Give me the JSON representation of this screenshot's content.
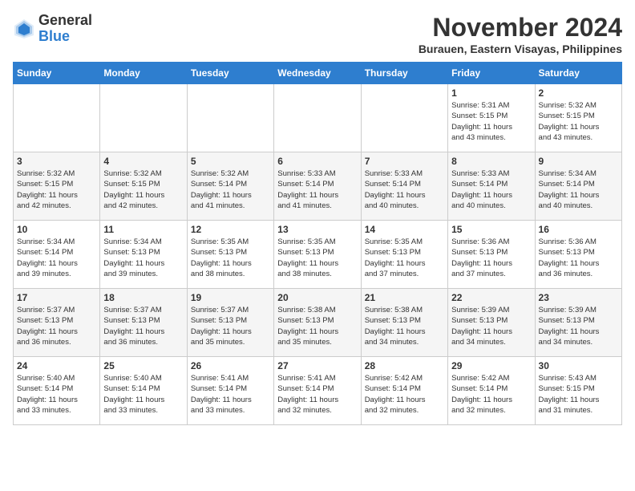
{
  "header": {
    "logo_general": "General",
    "logo_blue": "Blue",
    "month_year": "November 2024",
    "location": "Burauen, Eastern Visayas, Philippines"
  },
  "days_of_week": [
    "Sunday",
    "Monday",
    "Tuesday",
    "Wednesday",
    "Thursday",
    "Friday",
    "Saturday"
  ],
  "weeks": [
    [
      {
        "day": "",
        "info": ""
      },
      {
        "day": "",
        "info": ""
      },
      {
        "day": "",
        "info": ""
      },
      {
        "day": "",
        "info": ""
      },
      {
        "day": "",
        "info": ""
      },
      {
        "day": "1",
        "info": "Sunrise: 5:31 AM\nSunset: 5:15 PM\nDaylight: 11 hours\nand 43 minutes."
      },
      {
        "day": "2",
        "info": "Sunrise: 5:32 AM\nSunset: 5:15 PM\nDaylight: 11 hours\nand 43 minutes."
      }
    ],
    [
      {
        "day": "3",
        "info": "Sunrise: 5:32 AM\nSunset: 5:15 PM\nDaylight: 11 hours\nand 42 minutes."
      },
      {
        "day": "4",
        "info": "Sunrise: 5:32 AM\nSunset: 5:15 PM\nDaylight: 11 hours\nand 42 minutes."
      },
      {
        "day": "5",
        "info": "Sunrise: 5:32 AM\nSunset: 5:14 PM\nDaylight: 11 hours\nand 41 minutes."
      },
      {
        "day": "6",
        "info": "Sunrise: 5:33 AM\nSunset: 5:14 PM\nDaylight: 11 hours\nand 41 minutes."
      },
      {
        "day": "7",
        "info": "Sunrise: 5:33 AM\nSunset: 5:14 PM\nDaylight: 11 hours\nand 40 minutes."
      },
      {
        "day": "8",
        "info": "Sunrise: 5:33 AM\nSunset: 5:14 PM\nDaylight: 11 hours\nand 40 minutes."
      },
      {
        "day": "9",
        "info": "Sunrise: 5:34 AM\nSunset: 5:14 PM\nDaylight: 11 hours\nand 40 minutes."
      }
    ],
    [
      {
        "day": "10",
        "info": "Sunrise: 5:34 AM\nSunset: 5:14 PM\nDaylight: 11 hours\nand 39 minutes."
      },
      {
        "day": "11",
        "info": "Sunrise: 5:34 AM\nSunset: 5:13 PM\nDaylight: 11 hours\nand 39 minutes."
      },
      {
        "day": "12",
        "info": "Sunrise: 5:35 AM\nSunset: 5:13 PM\nDaylight: 11 hours\nand 38 minutes."
      },
      {
        "day": "13",
        "info": "Sunrise: 5:35 AM\nSunset: 5:13 PM\nDaylight: 11 hours\nand 38 minutes."
      },
      {
        "day": "14",
        "info": "Sunrise: 5:35 AM\nSunset: 5:13 PM\nDaylight: 11 hours\nand 37 minutes."
      },
      {
        "day": "15",
        "info": "Sunrise: 5:36 AM\nSunset: 5:13 PM\nDaylight: 11 hours\nand 37 minutes."
      },
      {
        "day": "16",
        "info": "Sunrise: 5:36 AM\nSunset: 5:13 PM\nDaylight: 11 hours\nand 36 minutes."
      }
    ],
    [
      {
        "day": "17",
        "info": "Sunrise: 5:37 AM\nSunset: 5:13 PM\nDaylight: 11 hours\nand 36 minutes."
      },
      {
        "day": "18",
        "info": "Sunrise: 5:37 AM\nSunset: 5:13 PM\nDaylight: 11 hours\nand 36 minutes."
      },
      {
        "day": "19",
        "info": "Sunrise: 5:37 AM\nSunset: 5:13 PM\nDaylight: 11 hours\nand 35 minutes."
      },
      {
        "day": "20",
        "info": "Sunrise: 5:38 AM\nSunset: 5:13 PM\nDaylight: 11 hours\nand 35 minutes."
      },
      {
        "day": "21",
        "info": "Sunrise: 5:38 AM\nSunset: 5:13 PM\nDaylight: 11 hours\nand 34 minutes."
      },
      {
        "day": "22",
        "info": "Sunrise: 5:39 AM\nSunset: 5:13 PM\nDaylight: 11 hours\nand 34 minutes."
      },
      {
        "day": "23",
        "info": "Sunrise: 5:39 AM\nSunset: 5:13 PM\nDaylight: 11 hours\nand 34 minutes."
      }
    ],
    [
      {
        "day": "24",
        "info": "Sunrise: 5:40 AM\nSunset: 5:14 PM\nDaylight: 11 hours\nand 33 minutes."
      },
      {
        "day": "25",
        "info": "Sunrise: 5:40 AM\nSunset: 5:14 PM\nDaylight: 11 hours\nand 33 minutes."
      },
      {
        "day": "26",
        "info": "Sunrise: 5:41 AM\nSunset: 5:14 PM\nDaylight: 11 hours\nand 33 minutes."
      },
      {
        "day": "27",
        "info": "Sunrise: 5:41 AM\nSunset: 5:14 PM\nDaylight: 11 hours\nand 32 minutes."
      },
      {
        "day": "28",
        "info": "Sunrise: 5:42 AM\nSunset: 5:14 PM\nDaylight: 11 hours\nand 32 minutes."
      },
      {
        "day": "29",
        "info": "Sunrise: 5:42 AM\nSunset: 5:14 PM\nDaylight: 11 hours\nand 32 minutes."
      },
      {
        "day": "30",
        "info": "Sunrise: 5:43 AM\nSunset: 5:15 PM\nDaylight: 11 hours\nand 31 minutes."
      }
    ]
  ]
}
